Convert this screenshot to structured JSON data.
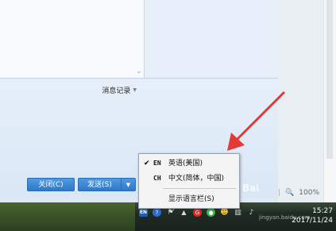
{
  "chat": {
    "record_label": "消息记录",
    "close_button": "关闭(C)",
    "send_button": "发送(S)"
  },
  "zoom": {
    "level": "100%",
    "separator": "|"
  },
  "language_menu": {
    "items": [
      {
        "code": "EN",
        "label": "英语(美国)",
        "checked": true
      },
      {
        "code": "CH",
        "label": "中文(简体，中国)",
        "checked": false
      }
    ],
    "show_language_bar": "显示语言栏(S)"
  },
  "taskbar": {
    "input_indicator": "EN",
    "time": "15:27",
    "date": "2017/11/24"
  },
  "watermark": {
    "brand": "Bai",
    "site": "jingyan.baidu.com"
  },
  "colors": {
    "arrow": "#e53935",
    "button": "#2f78c8",
    "menu_bg": "#f4f4f4"
  }
}
